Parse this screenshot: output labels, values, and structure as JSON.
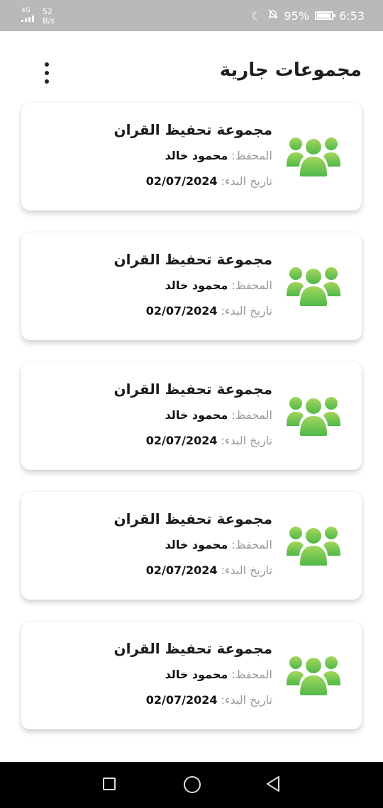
{
  "status_bar": {
    "network": "4G",
    "speed_value": "52",
    "speed_unit": "B/s",
    "battery": "95%",
    "battery_level": 0.95,
    "time": "6:53"
  },
  "header": {
    "title": "مجموعات جارية"
  },
  "groups": [
    {
      "title": "مجموعة تحفيظ القران",
      "teacher_label": "المحفظ:",
      "teacher": "محمود خالد",
      "date_label": "تاريخ البدء:",
      "date": "02/07/2024"
    },
    {
      "title": "مجموعة تحفيظ القران",
      "teacher_label": "المحفظ:",
      "teacher": "محمود خالد",
      "date_label": "تاريخ البدء:",
      "date": "02/07/2024"
    },
    {
      "title": "مجموعة تحفيظ القران",
      "teacher_label": "المحفظ:",
      "teacher": "محمود خالد",
      "date_label": "تاريخ البدء:",
      "date": "02/07/2024"
    },
    {
      "title": "مجموعة تحفيظ القران",
      "teacher_label": "المحفظ:",
      "teacher": "محمود خالد",
      "date_label": "تاريخ البدء:",
      "date": "02/07/2024"
    },
    {
      "title": "مجموعة تحفيظ القران",
      "teacher_label": "المحفظ:",
      "teacher": "محمود خالد",
      "date_label": "تاريخ البدء:",
      "date": "02/07/2024"
    }
  ],
  "colors": {
    "icon_green_light": "#a4d65e",
    "icon_green_dark": "#4fb848",
    "status_bar_bg": "#b9b9b9"
  },
  "icons": {
    "group": "group-icon",
    "more": "more-vertical-icon"
  }
}
